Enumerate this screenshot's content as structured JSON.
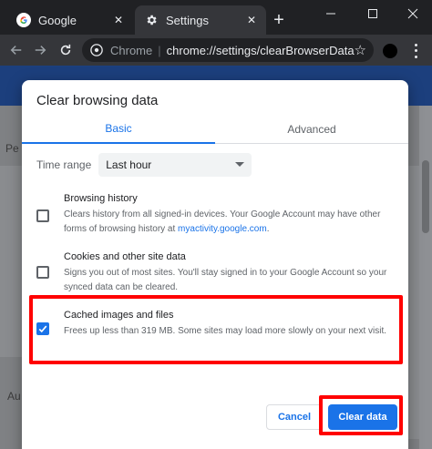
{
  "browser": {
    "tabs": [
      {
        "title": "Google",
        "icon": "google-g-icon",
        "active": false
      },
      {
        "title": "Settings",
        "icon": "gear-icon",
        "active": true
      }
    ],
    "new_tab_label": "+",
    "omnibox": {
      "site": "Chrome",
      "separator": "|",
      "url": "chrome://settings/clearBrowserData"
    }
  },
  "background_page": {
    "partial_text_1": "Pe",
    "partial_text_2": "Au"
  },
  "dialog": {
    "title": "Clear browsing data",
    "tabs": [
      {
        "label": "Basic",
        "active": true
      },
      {
        "label": "Advanced",
        "active": false
      }
    ],
    "time_range": {
      "label": "Time range",
      "selected": "Last hour"
    },
    "options": [
      {
        "title": "Browsing history",
        "desc_before_link": "Clears history from all signed-in devices. Your Google Account may have other forms of browsing history at ",
        "link": "myactivity.google.com",
        "desc_after_link": ".",
        "checked": false
      },
      {
        "title": "Cookies and other site data",
        "desc": "Signs you out of most sites. You'll stay signed in to your Google Account so your synced data can be cleared.",
        "checked": false
      },
      {
        "title": "Cached images and files",
        "desc": "Frees up less than 319 MB. Some sites may load more slowly on your next visit.",
        "checked": true
      }
    ],
    "buttons": {
      "cancel": "Cancel",
      "clear": "Clear data"
    }
  },
  "colors": {
    "accent": "#1a73e8",
    "highlight": "#ff0000",
    "chrome_dark": "#202124"
  }
}
